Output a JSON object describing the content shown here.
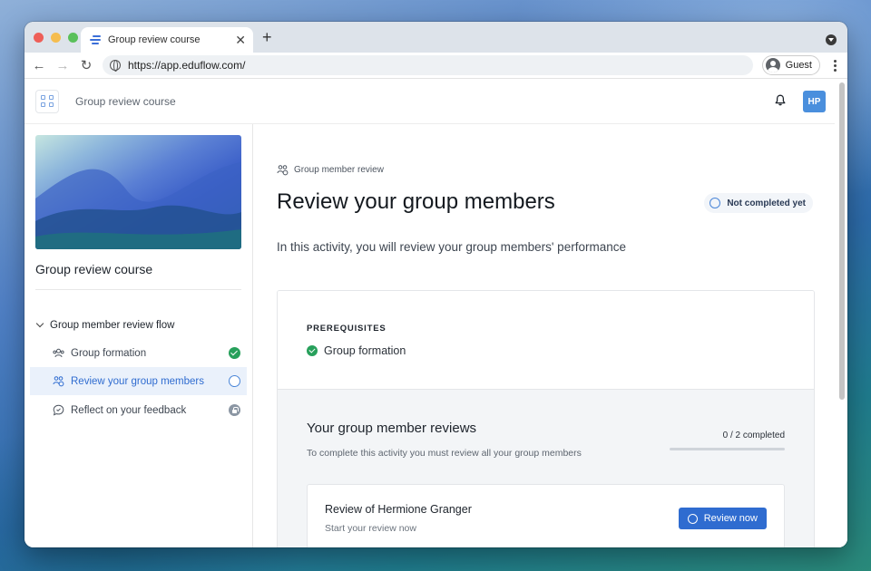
{
  "browser": {
    "tab_title": "Group review course",
    "new_tab": "+",
    "url": "https://app.eduflow.com/",
    "profile_label": "Guest"
  },
  "header": {
    "course_title": "Group review course",
    "avatar_initials": "HP"
  },
  "sidebar": {
    "course_name": "Group review course",
    "flow_title": "Group member review flow",
    "items": [
      {
        "label": "Group formation",
        "status": "completed",
        "icon": "group-icon"
      },
      {
        "label": "Review your group members",
        "status": "not-completed",
        "icon": "group-review-icon",
        "active": true
      },
      {
        "label": "Reflect on your feedback",
        "status": "locked",
        "icon": "chat-icon"
      }
    ]
  },
  "main": {
    "breadcrumb": "Group member review",
    "title": "Review your group members",
    "status": "Not completed yet",
    "intro": "In this activity, you will review your group members' performance",
    "prerequisites_label": "PREREQUISITES",
    "prerequisite_item": "Group formation",
    "reviews_title": "Your group member reviews",
    "reviews_subtitle": "To complete this activity you must review all your group members",
    "progress_text": "0 / 2 completed",
    "progress_fraction": 0,
    "review": {
      "name": "Review of Hermione Granger",
      "subtitle": "Start your review now",
      "button": "Review now"
    }
  },
  "colors": {
    "accent": "#2f6cd0",
    "success": "#27a05b",
    "avatar": "#4a8fdd"
  }
}
